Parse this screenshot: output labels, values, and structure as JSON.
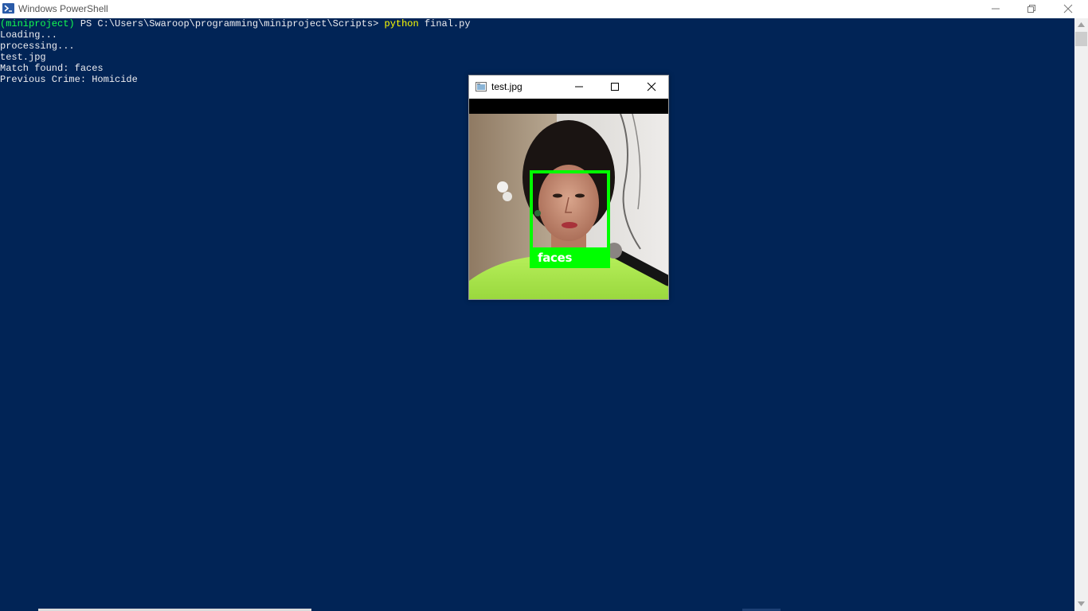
{
  "window": {
    "title": "Windows PowerShell",
    "icon": "powershell-icon"
  },
  "console": {
    "prompt_env": "(miniproject)",
    "prompt_path": " PS C:\\Users\\Swaroop\\programming\\miniproject\\Scripts> ",
    "command": "python",
    "command_args": " final.py",
    "output": [
      "Loading...",
      "processing...",
      "test.jpg",
      "Match found: faces",
      "Previous Crime: Homicide"
    ]
  },
  "viewer": {
    "title": "test.jpg",
    "icon": "image-window-icon",
    "detection_label": "faces",
    "box_color": "#00ff00"
  },
  "colors": {
    "console_bg": "#012456",
    "console_fg": "#eeedf0",
    "command_yellow": "#ffff00",
    "env_green": "#13ff4f"
  }
}
